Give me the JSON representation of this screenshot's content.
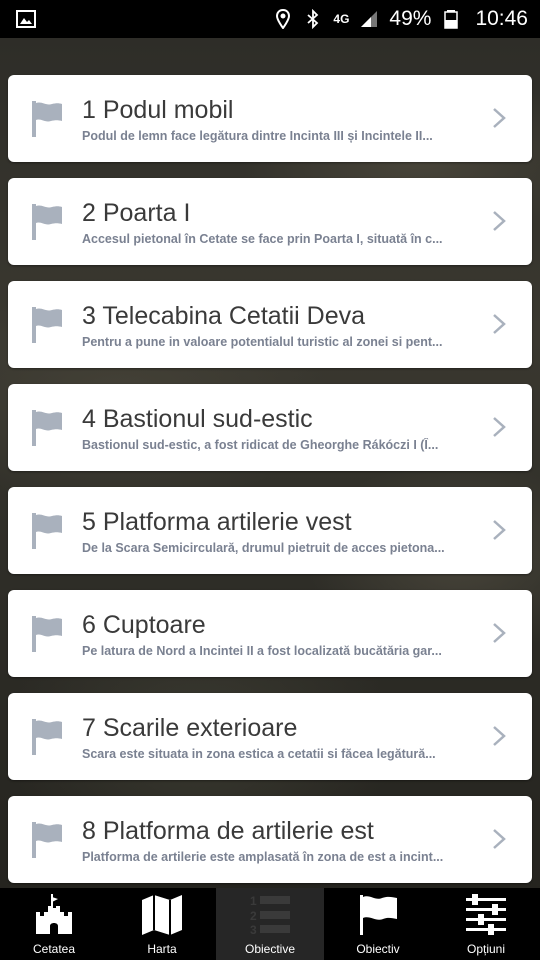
{
  "status_bar": {
    "network": "4G",
    "battery": "49%",
    "time": "10:46"
  },
  "items": [
    {
      "title": "1 Podul mobil",
      "desc": "Podul de lemn face legătura dintre Incinta III și Incintele II..."
    },
    {
      "title": "2 Poarta I",
      "desc": "Accesul pietonal în Cetate se face prin Poarta I, situată în c..."
    },
    {
      "title": "3 Telecabina Cetatii Deva",
      "desc": "Pentru a pune in valoare potentialul turistic al zonei si pent..."
    },
    {
      "title": "4 Bastionul sud-estic",
      "desc": "Bastionul sud-estic, a fost ridicat de Gheorghe Rákóczi I (Î..."
    },
    {
      "title": "5 Platforma artilerie vest",
      "desc": "De la Scara Semicirculară, drumul pietruit de acces pietona..."
    },
    {
      "title": "6 Cuptoare",
      "desc": "Pe latura de Nord a Incintei II a fost localizată bucătăria gar..."
    },
    {
      "title": "7 Scarile exterioare",
      "desc": "Scara este situata in zona estica a cetatii si făcea legătură..."
    },
    {
      "title": "8 Platforma de artilerie est",
      "desc": "Platforma de artilerie este amplasată în zona de est a incint..."
    }
  ],
  "tabs": [
    {
      "label": "Cetatea",
      "icon": "castle-icon"
    },
    {
      "label": "Harta",
      "icon": "map-icon"
    },
    {
      "label": "Obiective",
      "icon": "numbered-list-icon",
      "active": true
    },
    {
      "label": "Obiectiv",
      "icon": "flag-icon"
    },
    {
      "label": "Opțiuni",
      "icon": "sliders-icon"
    }
  ],
  "colors": {
    "card_bg": "#ffffff",
    "title": "#3a3a3a",
    "desc": "#7a8191",
    "flag": "#a9b1bd",
    "tabbar": "#000000",
    "tab_active": "#262626"
  }
}
